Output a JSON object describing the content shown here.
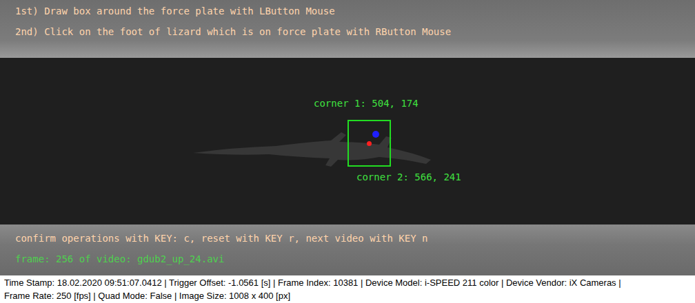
{
  "instructions": [
    "1st) Draw box around the force plate with LButton Mouse",
    "2nd) Click on the foot of lizard which is on force plate with RButton Mouse"
  ],
  "box": {
    "corner1": "corner 1: 504, 174",
    "corner2": "corner 2: 566, 241"
  },
  "markers": [
    {
      "color": "#1f1fff"
    },
    {
      "color": "#ff2020"
    }
  ],
  "hint": "confirm operations with KEY: c, reset with KEY r, next video with KEY n",
  "frame": "frame: 256 of video: gdub2_up_24.avi",
  "status_bar": [
    "Time Stamp: 18.02.2020 09:51:07.0412  |  Trigger Offset: -1.0561 [s]  |  Frame Index: 10381  |  Device Model: i-SPEED 211 color  |  Device Vendor: iX Cameras  |",
    "Frame Rate: 250 [fps]  |  Quad Mode: False  |  Image Size: 1008 x 400 [px]"
  ]
}
